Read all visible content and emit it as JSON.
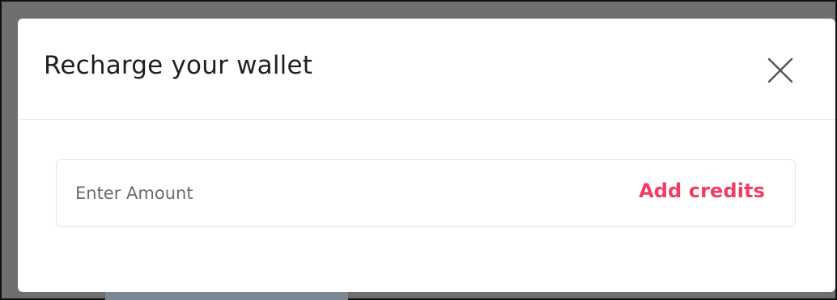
{
  "modal": {
    "title": "Recharge your wallet",
    "close_icon": "close-icon"
  },
  "amount": {
    "value": "",
    "placeholder": "Enter Amount"
  },
  "actions": {
    "add_credits_label": "Add credits"
  },
  "colors": {
    "accent": "#f23d63",
    "backdrop": "#6f6f6f",
    "modal_bg": "#ffffff",
    "border": "#e6e6e6",
    "title_text": "#1f1f1f",
    "placeholder_text": "#6b6b6b"
  }
}
